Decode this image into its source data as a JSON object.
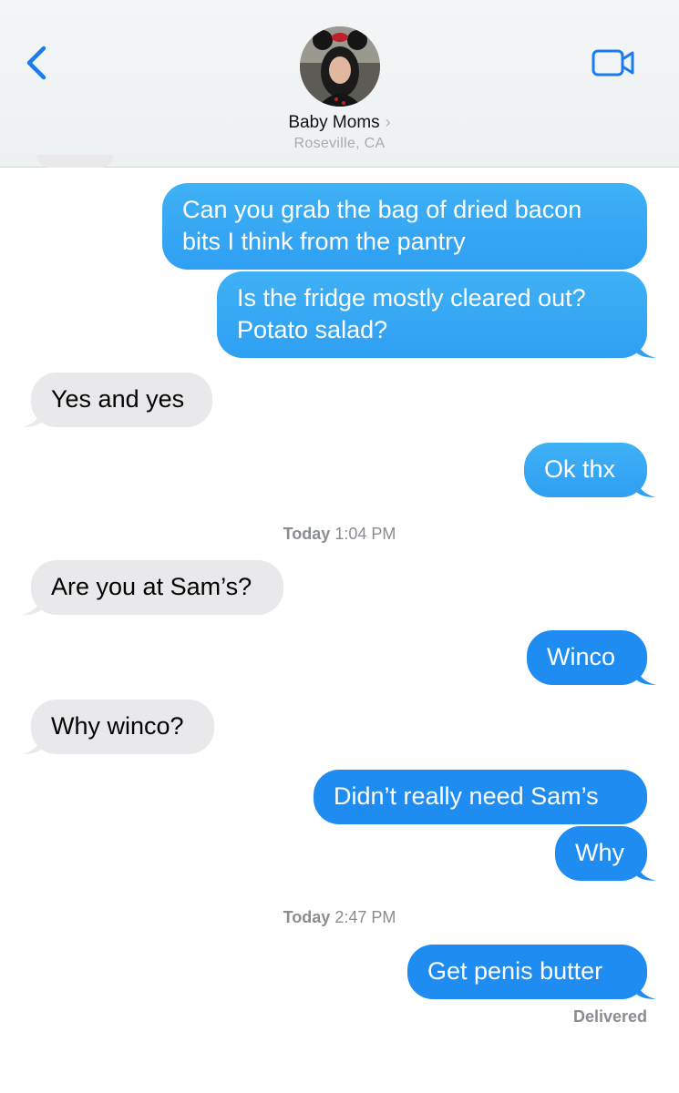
{
  "header": {
    "contact_name": "Baby Moms",
    "contact_location": "Roseville, CA",
    "back_icon": "chevron-left-icon",
    "video_icon": "video-camera-icon",
    "accent_color": "#1a7cf0"
  },
  "messages": [
    {
      "dir": "sent",
      "lines": [
        "Can you grab the bag of dried bacon",
        "bits I think from the pantry"
      ]
    },
    {
      "dir": "sent",
      "lines": [
        "Is the fridge mostly cleared out?",
        "Potato salad?"
      ]
    },
    {
      "dir": "received",
      "text": "Yes and yes"
    },
    {
      "dir": "sent",
      "text": "Ok thx"
    },
    {
      "dir": "received",
      "text": "Are you at Sam’s?"
    },
    {
      "dir": "sent",
      "text": "Winco"
    },
    {
      "dir": "received",
      "text": "Why winco?"
    },
    {
      "dir": "sent",
      "text": "Didn’t really need Sam’s"
    },
    {
      "dir": "sent",
      "text": "Why"
    },
    {
      "dir": "sent",
      "text": "Get penis butter"
    }
  ],
  "timestamps": [
    {
      "day": "Today",
      "time": "1:04 PM"
    },
    {
      "day": "Today",
      "time": "2:47 PM"
    }
  ],
  "status": {
    "delivered": "Delivered"
  }
}
